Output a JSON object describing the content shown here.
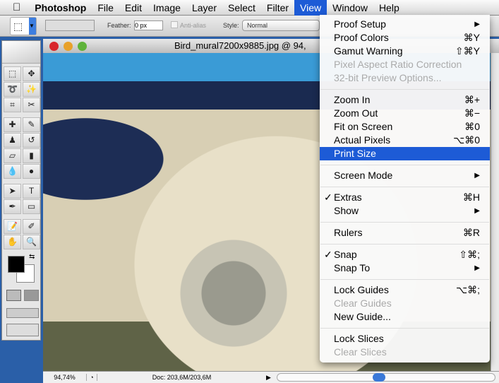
{
  "menubar": {
    "apple": "",
    "app": "Photoshop",
    "items": [
      "File",
      "Edit",
      "Image",
      "Layer",
      "Select",
      "Filter",
      "View",
      "Window",
      "Help"
    ],
    "active": "View"
  },
  "options": {
    "feather_label": "Feather:",
    "feather_value": "0 px",
    "antialias_label": "Anti-alias",
    "style_label": "Style:",
    "style_value": "Normal"
  },
  "document": {
    "title": "Bird_mural7200x9885.jpg @ 94,",
    "zoom": "94,74%",
    "doc_info": "Doc: 203,6M/203,6M"
  },
  "view_menu": [
    [
      {
        "label": "Proof Setup",
        "submenu": true
      },
      {
        "label": "Proof Colors",
        "shortcut": "⌘Y"
      },
      {
        "label": "Gamut Warning",
        "shortcut": "⇧⌘Y"
      },
      {
        "label": "Pixel Aspect Ratio Correction",
        "disabled": true
      },
      {
        "label": "32-bit Preview Options...",
        "disabled": true
      }
    ],
    [
      {
        "label": "Zoom In",
        "shortcut": "⌘+"
      },
      {
        "label": "Zoom Out",
        "shortcut": "⌘−"
      },
      {
        "label": "Fit on Screen",
        "shortcut": "⌘0"
      },
      {
        "label": "Actual Pixels",
        "shortcut": "⌥⌘0"
      },
      {
        "label": "Print Size",
        "highlighted": true
      }
    ],
    [
      {
        "label": "Screen Mode",
        "submenu": true
      }
    ],
    [
      {
        "label": "Extras",
        "shortcut": "⌘H",
        "checked": true
      },
      {
        "label": "Show",
        "submenu": true
      }
    ],
    [
      {
        "label": "Rulers",
        "shortcut": "⌘R"
      }
    ],
    [
      {
        "label": "Snap",
        "shortcut": "⇧⌘;",
        "checked": true
      },
      {
        "label": "Snap To",
        "submenu": true
      }
    ],
    [
      {
        "label": "Lock Guides",
        "shortcut": "⌥⌘;"
      },
      {
        "label": "Clear Guides",
        "disabled": true
      },
      {
        "label": "New Guide..."
      }
    ],
    [
      {
        "label": "Lock Slices"
      },
      {
        "label": "Clear Slices",
        "disabled": true
      }
    ]
  ],
  "tools": [
    "rect-marquee",
    "move",
    "lasso",
    "magic-wand",
    "crop",
    "slice",
    "healing-brush",
    "brush",
    "clone-stamp",
    "history-brush",
    "eraser",
    "gradient",
    "blur",
    "dodge",
    "path-select",
    "type",
    "pen",
    "shape",
    "notes",
    "eyedropper",
    "hand",
    "zoom"
  ],
  "tool_glyphs": [
    "⬚",
    "✥",
    "➰",
    "✨",
    "⌗",
    "✂",
    "✚",
    "✎",
    "♟",
    "↺",
    "▱",
    "▮",
    "💧",
    "●",
    "➤",
    "T",
    "✒",
    "▭",
    "📝",
    "✐",
    "✋",
    "🔍"
  ],
  "colors": {
    "accent": "#1d5bd6",
    "foreground": "#000000",
    "background": "#ffffff"
  }
}
